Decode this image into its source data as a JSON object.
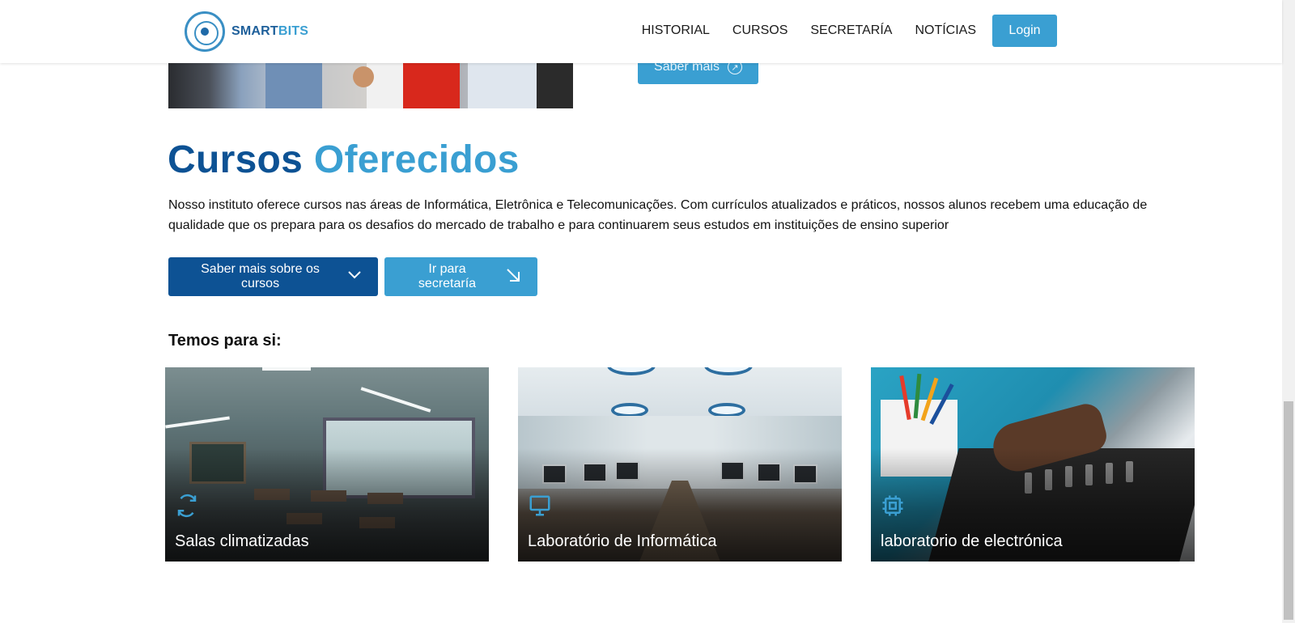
{
  "brand": {
    "name_part1": "SMART",
    "name_part2": "BITS",
    "color_primary": "#0d5294",
    "color_accent": "#3a9fd2"
  },
  "nav": {
    "items": [
      {
        "label": "HISTORIAL"
      },
      {
        "label": "CURSOS"
      },
      {
        "label": "SECRETARÍA"
      },
      {
        "label": "NOTÍCIAS"
      }
    ],
    "login_label": "Login"
  },
  "hero": {
    "more_button_label": "Saber mais",
    "more_button_icon": "circle-arrow-icon"
  },
  "courses": {
    "title_part1": "Cursos",
    "title_part2": "Oferecidos",
    "description": "Nosso instituto oferece cursos nas áreas de Informática, Eletrônica e Telecomunicações. Com currículos atualizados e práticos, nossos alunos recebem uma educação de qualidade que os prepara para os desafios do mercado de trabalho e para continuarem seus estudos em instituições de ensino superior",
    "primary_button_label": "Saber mais sobre os cursos",
    "primary_button_icon": "chevron-down-icon",
    "secondary_button_label": "Ir para secretaría",
    "secondary_button_icon": "arrow-down-right-icon"
  },
  "features": {
    "heading": "Temos para si:",
    "cards": [
      {
        "label": "Salas climatizadas",
        "icon": "refresh-icon"
      },
      {
        "label": "Laboratório de Informática",
        "icon": "monitor-icon"
      },
      {
        "label": "laboratorio de electrónica",
        "icon": "cpu-icon"
      }
    ]
  }
}
